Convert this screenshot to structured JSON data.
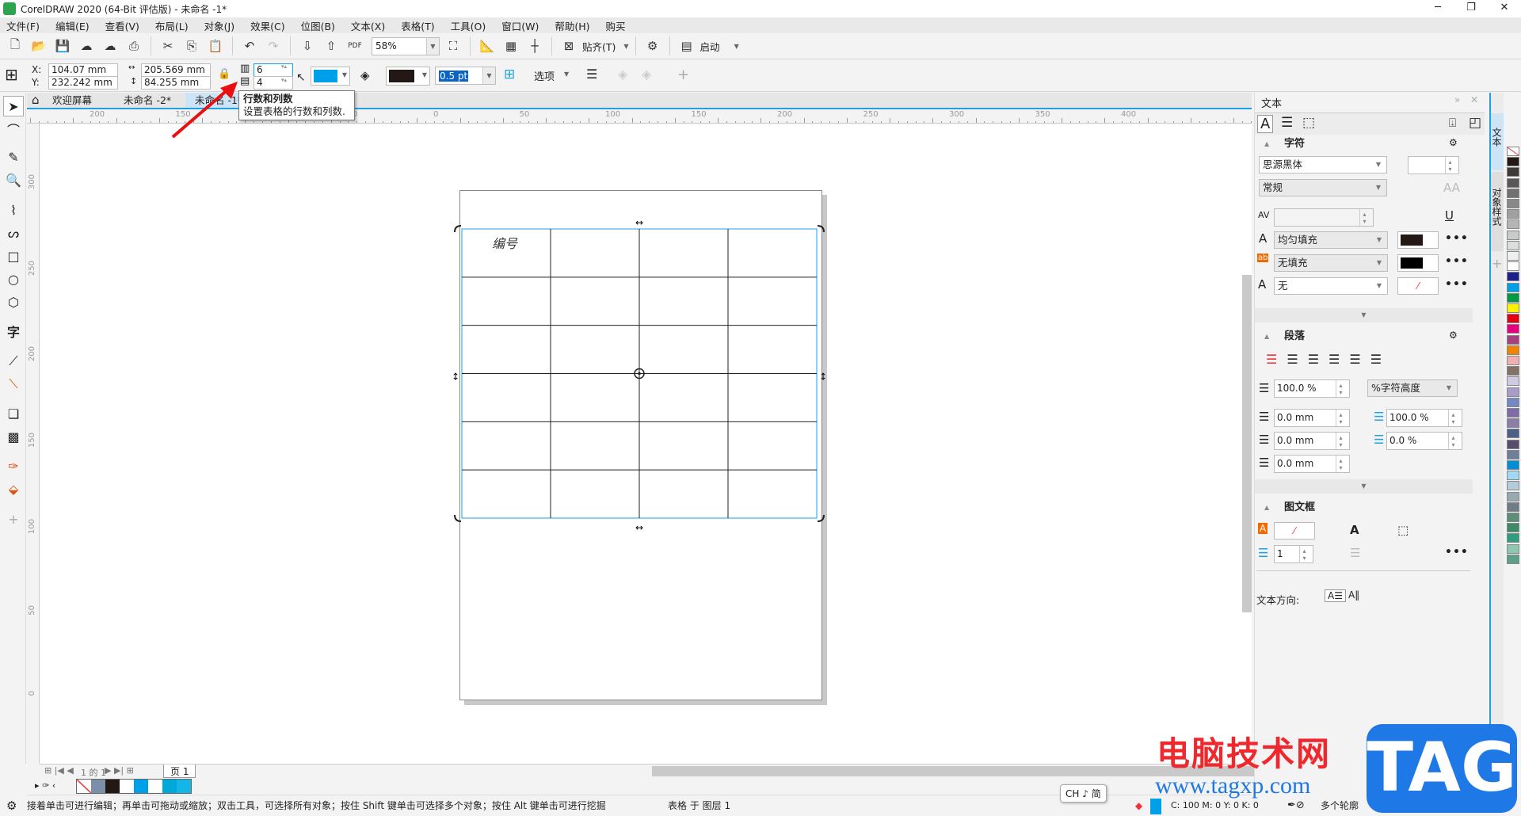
{
  "window": {
    "title": "CorelDRAW 2020 (64-Bit 评估版) - 未命名 -1*"
  },
  "menu": [
    "文件(F)",
    "编辑(E)",
    "查看(V)",
    "布局(L)",
    "对象(J)",
    "效果(C)",
    "位图(B)",
    "文本(X)",
    "表格(T)",
    "工具(O)",
    "窗口(W)",
    "帮助(H)",
    "购买"
  ],
  "toolbar": {
    "zoom": "58%",
    "snap": "贴齐(T)",
    "launch": "启动"
  },
  "propbar": {
    "x_label": "X:",
    "y_label": "Y:",
    "x": "104.07 mm",
    "y": "232.242 mm",
    "width": "205.569 mm",
    "height": "84.255 mm",
    "rows": "6",
    "cols": "4",
    "fill_color": "#00a0e9",
    "outline_color": "#231815",
    "outline_width": "0.5 pt",
    "options": "选项"
  },
  "tabs": [
    {
      "label": "欢迎屏幕"
    },
    {
      "label": "未命名 -2*"
    },
    {
      "label": "未命名 -1*",
      "active": true
    }
  ],
  "tooltip": {
    "title": "行数和列数",
    "desc": "设置表格的行数和列数."
  },
  "hruler": [
    "200",
    "150",
    "100",
    "50",
    "0",
    "50",
    "100",
    "150",
    "200",
    "250",
    "300",
    "350",
    "400"
  ],
  "vruler": [
    "300",
    "250",
    "200",
    "150",
    "100",
    "50",
    "0"
  ],
  "table": {
    "rows": 6,
    "cols": 4,
    "cell_text": "编号"
  },
  "docker": {
    "title": "文本",
    "character": {
      "title": "字符",
      "font": "思源黑体",
      "style": "常规",
      "fill_type": "均匀填充",
      "fill_color": "#231815",
      "bg_fill": "无填充",
      "bg_color": "#000000",
      "outline": "无"
    },
    "paragraph": {
      "title": "段落",
      "line_spacing": "100.0 %",
      "line_spacing_unit": "%字符高度",
      "indent_first": "0.0 mm",
      "indent_left": "0.0 mm",
      "indent_right": "0.0 mm",
      "before_para": "100.0 %",
      "after_para": "0.0 %"
    },
    "frame": {
      "title": "图文框",
      "columns": "1",
      "text_direction_label": "文本方向:"
    }
  },
  "side_tabs": [
    "文本",
    "对象样式"
  ],
  "palette": [
    "none",
    "#231815",
    "#3e3a39",
    "#595757",
    "#727171",
    "#898989",
    "#9fa0a0",
    "#b5b5b6",
    "#c9caca",
    "#dcdddd",
    "#efefef",
    "#ffffff",
    "#1d2088",
    "#00a0e9",
    "#009944",
    "#fff100",
    "#e60012",
    "#e4007f",
    "#a7407e",
    "#f08300",
    "#f1b0b0",
    "#847168",
    "#d0cbe3",
    "#a99cc8",
    "#7289c4",
    "#7e6ba8",
    "#8c7ea8",
    "#4e5f87",
    "#574e6c",
    "#6d7f99",
    "#008fd7",
    "#9fd9f6",
    "#b4ccd9",
    "#98a9b2",
    "#6f7e86",
    "#5c8f7a",
    "#3e8b6a",
    "#2f9c7d",
    "#8fc8b0",
    "#5aa08a"
  ],
  "doc_palette": [
    "none",
    "#7b8fa8",
    "#231815",
    "#ffffff",
    "#00a0e9",
    "#ffffff",
    "#00a8d8",
    "#14b6ea"
  ],
  "pagenav": {
    "counter": "1 的 1",
    "page_tab": "页 1"
  },
  "ime": "CH ♪ 简",
  "status": {
    "hint": "接着单击可进行编辑；再单击可拖动或缩放；双击工具，可选择所有对象；按住 Shift 键单击可选择多个对象；按住 Alt 键单击可进行挖掘",
    "layer": "表格 于 图层 1",
    "color_readout": "C:  100 M:  0 Y:  0 K:  0",
    "outline_label": "多个轮廓"
  },
  "watermark": {
    "site_name": "电脑技术网",
    "url": "www.tagxp.com",
    "logo": "TAG"
  }
}
